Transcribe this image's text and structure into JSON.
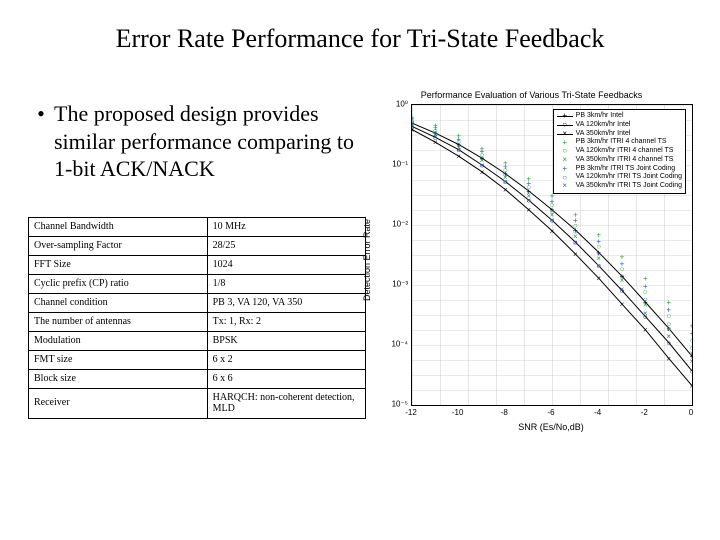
{
  "title": "Error Rate Performance for Tri-State Feedback",
  "bullet": "The proposed design provides similar performance comparing to 1-bit ACK/NACK",
  "params": [
    {
      "k": "Channel Bandwidth",
      "v": "10 MHz"
    },
    {
      "k": "Over-sampling Factor",
      "v": "28/25"
    },
    {
      "k": "FFT Size",
      "v": "1024"
    },
    {
      "k": "Cyclic prefix (CP) ratio",
      "v": "1/8"
    },
    {
      "k": "Channel condition",
      "v": "PB 3, VA 120, VA 350"
    },
    {
      "k": "The number of antennas",
      "v": "Tx: 1, Rx: 2"
    },
    {
      "k": "Modulation",
      "v": "BPSK"
    },
    {
      "k": "FMT size",
      "v": "6 x 2"
    },
    {
      "k": "Block size",
      "v": "6 x 6"
    },
    {
      "k": "Receiver",
      "v": "HARQCH: non-coherent detection, MLD"
    }
  ],
  "chart_data": {
    "type": "line",
    "title": "Performance Evaluation of Various Tri-State Feedbacks",
    "xlabel": "SNR (Es/No,dB)",
    "ylabel": "Detection Error Rate",
    "xlim": [
      -12,
      0
    ],
    "ylim_log10": [
      -5,
      0
    ],
    "series": [
      {
        "name": "PB 3km/hr Intel",
        "color": "#000000",
        "marker": "+",
        "lined": true,
        "x": [
          -12,
          -11,
          -10,
          -9,
          -8,
          -7,
          -6,
          -5,
          -4,
          -3,
          -2,
          -1,
          0
        ],
        "y": [
          0.5,
          0.34,
          0.22,
          0.13,
          0.072,
          0.037,
          0.018,
          0.0083,
          0.0035,
          0.0014,
          0.00052,
          0.00019,
          6.5e-05
        ]
      },
      {
        "name": "VA 120km/hr Intel",
        "color": "#000000",
        "marker": "o",
        "lined": true,
        "x": [
          -12,
          -11,
          -10,
          -9,
          -8,
          -7,
          -6,
          -5,
          -4,
          -3,
          -2,
          -1,
          0
        ],
        "y": [
          0.44,
          0.29,
          0.18,
          0.1,
          0.053,
          0.026,
          0.012,
          0.0052,
          0.0021,
          0.00081,
          0.0003,
          0.00011,
          3.7e-05
        ]
      },
      {
        "name": "VA 350km/hr Intel",
        "color": "#000000",
        "marker": "x",
        "lined": true,
        "x": [
          -12,
          -11,
          -10,
          -9,
          -8,
          -7,
          -6,
          -5,
          -4,
          -3,
          -2,
          -1,
          0
        ],
        "y": [
          0.39,
          0.24,
          0.14,
          0.077,
          0.039,
          0.018,
          0.008,
          0.0033,
          0.0013,
          0.00048,
          0.00018,
          6e-05,
          2.1e-05
        ]
      },
      {
        "name": "PB 3km/hr ITRI 4 channel TS",
        "color": "#1ea82a",
        "marker": "+",
        "lined": false,
        "x": [
          -12,
          -11,
          -10,
          -9,
          -8,
          -7,
          -6,
          -5,
          -4,
          -3,
          -2,
          -1,
          0
        ],
        "y": [
          0.63,
          0.46,
          0.31,
          0.19,
          0.11,
          0.06,
          0.031,
          0.015,
          0.0069,
          0.003,
          0.0013,
          0.00052,
          0.00021
        ]
      },
      {
        "name": "VA 120km/hr ITRI 4 channel TS",
        "color": "#1ea82a",
        "marker": "o",
        "lined": false,
        "x": [
          -12,
          -11,
          -10,
          -9,
          -8,
          -7,
          -6,
          -5,
          -4,
          -3,
          -2,
          -1,
          0
        ],
        "y": [
          0.55,
          0.38,
          0.25,
          0.15,
          0.084,
          0.044,
          0.022,
          0.01,
          0.0045,
          0.0019,
          0.00078,
          0.00031,
          0.00012
        ]
      },
      {
        "name": "VA 350km/hr ITRI 4 channel TS",
        "color": "#1ea82a",
        "marker": "x",
        "lined": false,
        "x": [
          -12,
          -11,
          -10,
          -9,
          -8,
          -7,
          -6,
          -5,
          -4,
          -3,
          -2,
          -1,
          0
        ],
        "y": [
          0.49,
          0.33,
          0.2,
          0.12,
          0.063,
          0.031,
          0.015,
          0.0066,
          0.0028,
          0.0012,
          0.00047,
          0.00019,
          7.4e-05
        ]
      },
      {
        "name": "PB 3km/hr ITRI TS Joint Coding",
        "color": "#2a5bd7",
        "marker": "+",
        "lined": false,
        "x": [
          -12,
          -11,
          -10,
          -9,
          -8,
          -7,
          -6,
          -5,
          -4,
          -3,
          -2,
          -1,
          0
        ],
        "y": [
          0.59,
          0.42,
          0.27,
          0.17,
          0.095,
          0.05,
          0.025,
          0.012,
          0.0054,
          0.0023,
          0.00096,
          0.00039,
          0.00016
        ]
      },
      {
        "name": "VA 120km/hr ITRI TS Joint Coding",
        "color": "#2a5bd7",
        "marker": "o",
        "lined": false,
        "x": [
          -12,
          -11,
          -10,
          -9,
          -8,
          -7,
          -6,
          -5,
          -4,
          -3,
          -2,
          -1,
          0
        ],
        "y": [
          0.52,
          0.35,
          0.22,
          0.13,
          0.071,
          0.036,
          0.017,
          0.0079,
          0.0034,
          0.0014,
          0.00058,
          0.00023,
          9.1e-05
        ]
      },
      {
        "name": "VA 350km/hr ITRI TS Joint Coding",
        "color": "#2a5bd7",
        "marker": "x",
        "lined": false,
        "x": [
          -12,
          -11,
          -10,
          -9,
          -8,
          -7,
          -6,
          -5,
          -4,
          -3,
          -2,
          -1,
          0
        ],
        "y": [
          0.46,
          0.3,
          0.18,
          0.1,
          0.053,
          0.026,
          0.012,
          0.0051,
          0.0021,
          0.00086,
          0.00034,
          0.00014,
          5.4e-05
        ]
      }
    ]
  }
}
